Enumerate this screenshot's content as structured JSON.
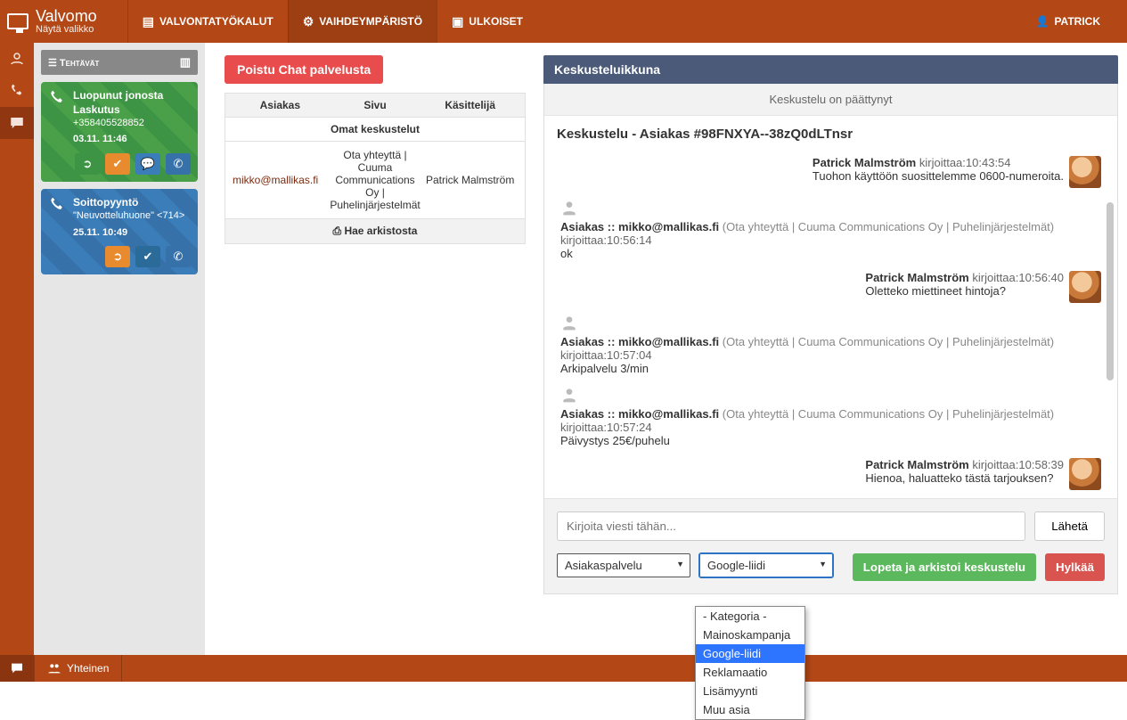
{
  "brand": {
    "title": "Valvomo",
    "subtitle": "Näytä valikko"
  },
  "nav": {
    "items": [
      {
        "label": "VALVONTATYÖKALUT"
      },
      {
        "label": "VAIHDEYMPÄRISTÖ"
      },
      {
        "label": "ULKOISET"
      }
    ],
    "user": "PATRICK"
  },
  "side": {
    "header": "Tehtävät",
    "card1": {
      "title": "Luopunut jonosta",
      "sub": "Laskutus",
      "phone": "+358405528852",
      "time": "03.11. 11:46"
    },
    "card2": {
      "title": "Soittopyyntö",
      "sub": "\"Neuvotteluhuone\" <714>",
      "time": "25.11. 10:49"
    }
  },
  "chat_list": {
    "exit": "Poistu Chat palvelusta",
    "cols": {
      "c1": "Asiakas",
      "c2": "Sivu",
      "c3": "Käsittelijä"
    },
    "section": "Omat keskustelut",
    "row": {
      "c1": "mikko@mallikas.fi",
      "c2": "Ota yhteyttä | Cuuma Communications Oy | Puhelinjärjestelmät",
      "c3": "Patrick Malmström"
    },
    "archive": "Hae arkistosta"
  },
  "conv": {
    "header": "Keskusteluikkuna",
    "ended": "Keskustelu on päättynyt",
    "title": "Keskustelu - Asiakas #98FNXYA--38zQ0dLTnsr",
    "labels": {
      "writes": "kirjoittaa:"
    },
    "agent": "Patrick Malmström",
    "client": "Asiakas :: mikko@mallikas.fi",
    "src": "(Ota yhteyttä | Cuuma Communications Oy | Puhelinjärjestelmät)",
    "m1": {
      "time": "10:43:54",
      "text": "Tuohon käyttöön suosittelemme 0600-numeroita."
    },
    "m2": {
      "time": "10:56:14",
      "text": "ok"
    },
    "m3": {
      "time": "10:56:40",
      "text": "Oletteko miettineet hintoja?"
    },
    "m4": {
      "time": "10:57:04",
      "text": "Arkipalvelu 3/min"
    },
    "m5": {
      "time": "10:57:24",
      "text": "Päivystys 25€/puhelu"
    },
    "m6": {
      "time": "10:58:39",
      "text": "Hienoa, haluatteko tästä tarjouksen?"
    }
  },
  "compose": {
    "placeholder": "Kirjoita viesti tähän...",
    "send": "Lähetä",
    "select1": "Asiakaspalvelu",
    "select2": "Google-liidi",
    "archive": "Lopeta ja arkistoi keskustelu",
    "reject": "Hylkää"
  },
  "dropdown": {
    "opt0": "- Kategoria -",
    "opt1": "Mainoskampanja",
    "opt2": "Google-liidi",
    "opt3": "Reklamaatio",
    "opt4": "Lisämyynti",
    "opt5": "Muu asia"
  },
  "bottom": {
    "shared": "Yhteinen"
  }
}
